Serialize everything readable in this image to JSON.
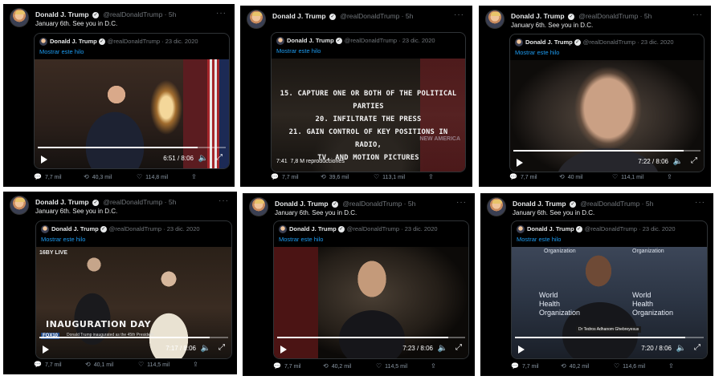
{
  "tweets": [
    {
      "author": "Donald J. Trump",
      "handle": "@realDonaldTrump · 5h",
      "text": "January 6th. See you in D.C.",
      "quote": {
        "author": "Donald J. Trump",
        "handle": "@realDonaldTrump · 23 dic. 2020",
        "show_thread": "Mostrar este hilo"
      },
      "time": "6:51 / 8:06",
      "progress": 0.85,
      "replies": "7,7 mil",
      "retweets": "40,3 mil",
      "likes": "114,8 mil"
    },
    {
      "author": "Donald J. Trump",
      "handle": "@realDonaldTrump · 5h",
      "quote": {
        "author": "Donald J. Trump",
        "handle": "@realDonaldTrump · 23 dic. 2020",
        "show_thread": "Mostrar este hilo"
      },
      "overlay_lines": [
        "15. CAPTURE ONE OR BOTH OF THE POLITICAL PARTIES",
        "20. INFILTRATE THE PRESS",
        "21. GAIN CONTROL OF KEY POSITIONS IN RADIO,",
        "TV, AND MOTION PICTURES"
      ],
      "watermark": "NEW AMERICA",
      "time": "7:41",
      "views": "7,8 M reproducciones",
      "replies": "7,7 mil",
      "retweets": "39,6 mil",
      "likes": "113,1 mil"
    },
    {
      "author": "Donald J. Trump",
      "handle": "@realDonaldTrump · 5h",
      "text": "January 6th. See you in D.C.",
      "quote": {
        "author": "Donald J. Trump",
        "handle": "@realDonaldTrump · 23 dic. 2020",
        "show_thread": "Mostrar este hilo"
      },
      "time": "7:22 / 8:06",
      "progress": 0.91,
      "replies": "7,7 mil",
      "retweets": "40 mil",
      "likes": "114,1 mil"
    },
    {
      "author": "Donald J. Trump",
      "handle": "@realDonaldTrump · 5h",
      "text": "January 6th. See you in D.C.",
      "quote": {
        "author": "Donald J. Trump",
        "handle": "@realDonaldTrump · 23 dic. 2020",
        "show_thread": "Mostrar este hilo"
      },
      "network": "16BY LIVE",
      "chyron": "INAUGURATION DAY",
      "chyron_sub": "Donald Trump inaugurated as the 45th President",
      "station": "FOX10",
      "time": "7:17 / 8:06",
      "progress": 0.9,
      "replies": "7,7 mil",
      "retweets": "40,1 mil",
      "likes": "114,5 mil"
    },
    {
      "author": "Donald J. Trump",
      "handle": "@realDonaldTrump · 5h",
      "text": "January 6th. See you in D.C.",
      "quote": {
        "author": "Donald J. Trump",
        "handle": "@realDonaldTrump · 23 dic. 2020",
        "show_thread": "Mostrar este hilo"
      },
      "time": "7:23 / 8:06",
      "progress": 0.91,
      "replies": "7,7 mil",
      "retweets": "40,2 mil",
      "likes": "114,5 mil"
    },
    {
      "author": "Donald J. Trump",
      "handle": "@realDonaldTrump · 5h",
      "text": "January 6th. See you in D.C.",
      "quote": {
        "author": "Donald J. Trump",
        "handle": "@realDonaldTrump · 23 dic. 2020",
        "show_thread": "Mostrar este hilo"
      },
      "who_top": "Organization",
      "who_mid": "World Health Organization",
      "nameplate": "Dr Tedros Adhanom Ghebreyesus",
      "time": "7:20 / 8:06",
      "progress": 0.9,
      "replies": "7,7 mil",
      "retweets": "40,2 mil",
      "likes": "114,6 mil"
    }
  ],
  "icons": {
    "reply": "reply-icon",
    "retweet": "retweet-icon",
    "like": "heart-icon",
    "share": "share-icon"
  },
  "colors": {
    "link": "#1d9bf0",
    "muted": "#71767b",
    "background": "#000000"
  }
}
